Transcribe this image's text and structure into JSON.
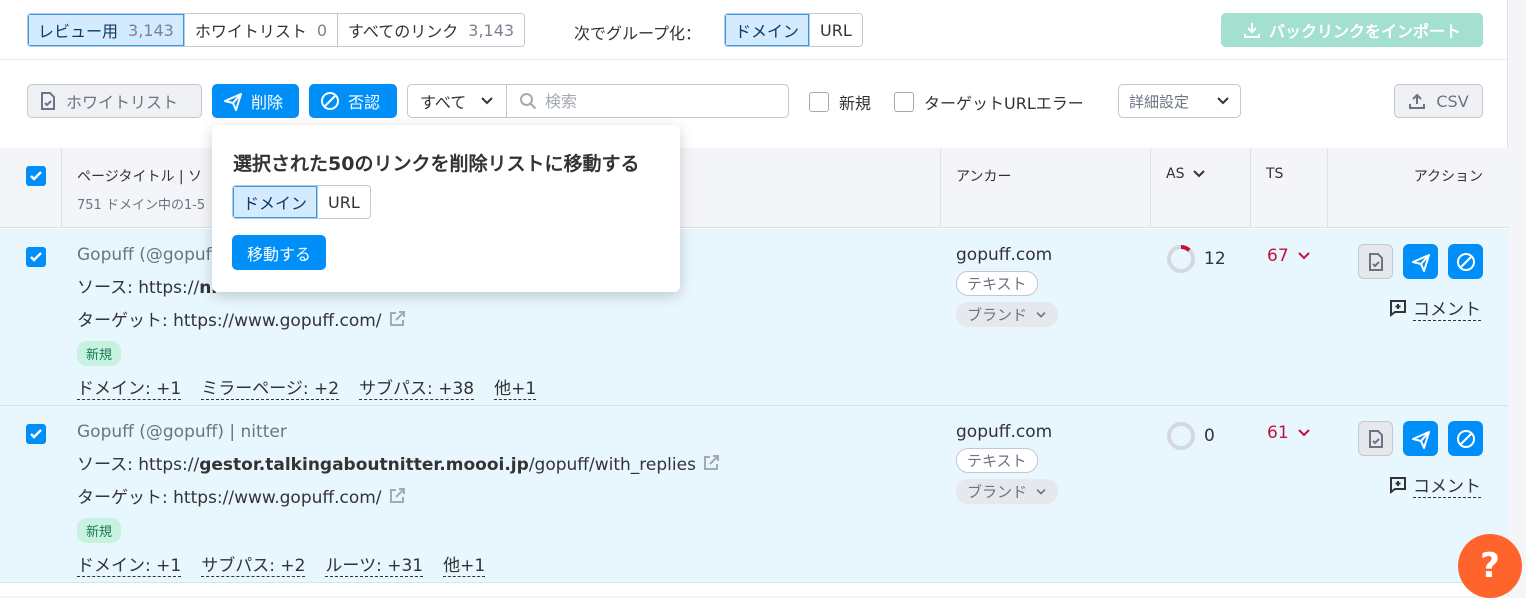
{
  "tabs": [
    {
      "label": "レビュー用",
      "count": "3,143"
    },
    {
      "label": "ホワイトリスト",
      "count": "0"
    },
    {
      "label": "すべてのリンク",
      "count": "3,143"
    }
  ],
  "group_by": {
    "label": "次でグループ化：",
    "options": [
      "ドメイン",
      "URL"
    ]
  },
  "import_label": "バックリンクをインポート",
  "toolbar": {
    "whitelist_label": "ホワイトリスト",
    "delete_label": "削除",
    "disavow_label": "否認",
    "filter_value": "すべて",
    "search_placeholder": "検索",
    "new_label": "新規",
    "target_error_label": "ターゲットURLエラー",
    "advanced_label": "詳細設定",
    "csv_label": "CSV"
  },
  "columns": {
    "title": "ページタイトル | ソ",
    "title_sub": "751 ドメイン中の1-5",
    "anchor": "アンカー",
    "as": "AS",
    "ts": "TS",
    "action": "アクション"
  },
  "rows": [
    {
      "title": "Gopuff (@gopuff",
      "source_prefix": "ソース: https://",
      "source_bold": "ni",
      "source_rest": "",
      "target": "ターゲット: https://www.gopuff.com/",
      "badge": "新規",
      "links": [
        "ドメイン: +1",
        "ミラーページ: +2",
        "サブパス: +38",
        "他+1"
      ],
      "anchor": "gopuff.com",
      "anchor_type": "テキスト",
      "anchor_tag": "ブランド",
      "as": "12",
      "as_fraction": 0.12,
      "ts": "67",
      "comment": "コメント"
    },
    {
      "title": "Gopuff (@gopuff) | nitter",
      "source_prefix": "ソース: https://",
      "source_bold": "gestor.talkingaboutnitter.moooi.jp",
      "source_rest": "/gopuff/with_replies",
      "target": "ターゲット: https://www.gopuff.com/",
      "badge": "新規",
      "links": [
        "ドメイン: +1",
        "サブパス: +2",
        "ルーツ: +31",
        "他+1"
      ],
      "anchor": "gopuff.com",
      "anchor_type": "テキスト",
      "anchor_tag": "ブランド",
      "as": "0",
      "as_fraction": 0,
      "ts": "61",
      "comment": "コメント"
    }
  ],
  "popup": {
    "title": "選択された50のリンクを削除リストに移動する",
    "options": [
      "ドメイン",
      "URL"
    ],
    "move_label": "移動する"
  },
  "help_label": "?",
  "colors": {
    "accent": "#008ff8",
    "ts_red": "#c5113c",
    "row_bg": "#e8f6fe",
    "help": "#ff642d",
    "import": "#a3e0d0"
  }
}
